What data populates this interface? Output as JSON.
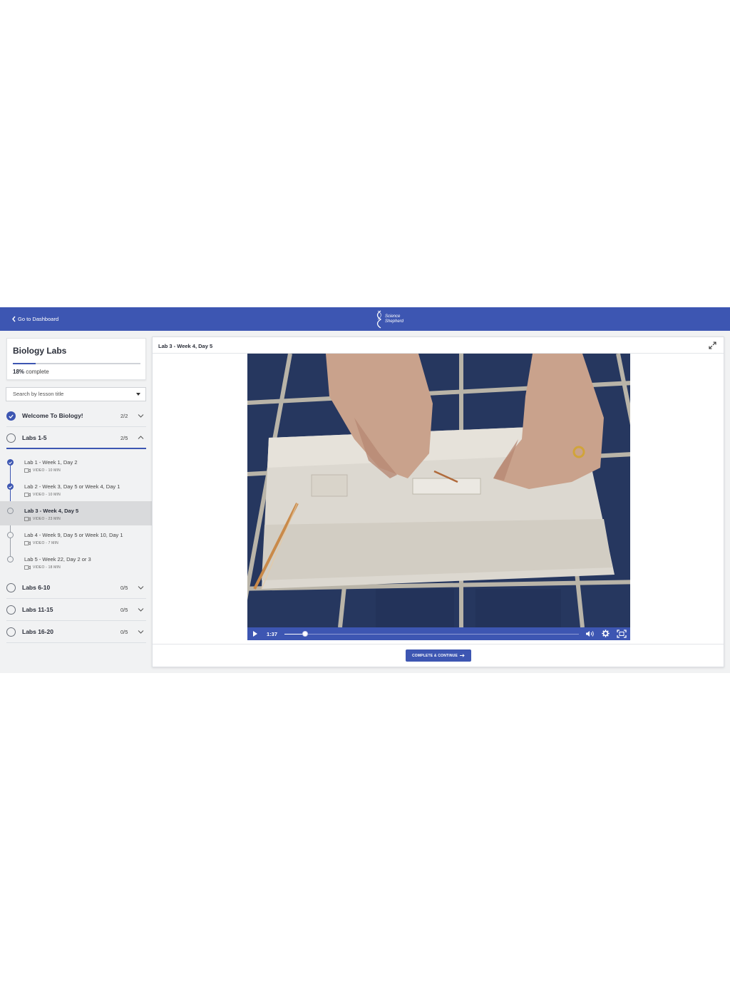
{
  "header": {
    "back_label": "Go to Dashboard",
    "logo_line1": "Science",
    "logo_line2": "Shepherd",
    "brand_color": "#3d56b2"
  },
  "course": {
    "title": "Biology Labs",
    "progress_percent": 18,
    "progress_percent_label": "18%",
    "progress_suffix": " complete"
  },
  "search": {
    "placeholder": "Search by lesson title"
  },
  "sections": [
    {
      "title": "Welcome To Biology!",
      "count": "2/2",
      "completed": true,
      "expanded": false
    },
    {
      "title": "Labs 1-5",
      "count": "2/5",
      "completed": false,
      "expanded": true
    },
    {
      "title": "Labs 6-10",
      "count": "0/5",
      "completed": false,
      "expanded": false
    },
    {
      "title": "Labs 11-15",
      "count": "0/5",
      "completed": false,
      "expanded": false
    },
    {
      "title": "Labs 16-20",
      "count": "0/5",
      "completed": false,
      "expanded": false
    }
  ],
  "lessons": [
    {
      "title": "Lab 1 - Week 1, Day 2",
      "meta": "VIDEO - 10 MIN",
      "completed": true,
      "current": false
    },
    {
      "title": "Lab 2 - Week 3, Day 5 or Week 4, Day 1",
      "meta": "VIDEO - 10 MIN",
      "completed": true,
      "current": false
    },
    {
      "title": "Lab 3 - Week 4, Day 5",
      "meta": "VIDEO - 23 MIN",
      "completed": false,
      "current": true
    },
    {
      "title": "Lab 4 - Week 9, Day 5 or Week 10, Day 1",
      "meta": "VIDEO - 7 MIN",
      "completed": false,
      "current": false
    },
    {
      "title": "Lab 5 - Week 22, Day 2 or 3",
      "meta": "VIDEO - 18 MIN",
      "completed": false,
      "current": false
    }
  ],
  "main": {
    "title": "Lab 3 - Week 4, Day 5",
    "expand_icon": "expand-arrows-icon"
  },
  "player": {
    "time": "1:37",
    "progress_fraction": 0.07,
    "play_icon": "play-icon",
    "volume_icon": "volume-icon",
    "settings_icon": "gear-icon",
    "fullscreen_icon": "fullscreen-icon"
  },
  "footer": {
    "complete_label": "COMPLETE & CONTINUE"
  }
}
